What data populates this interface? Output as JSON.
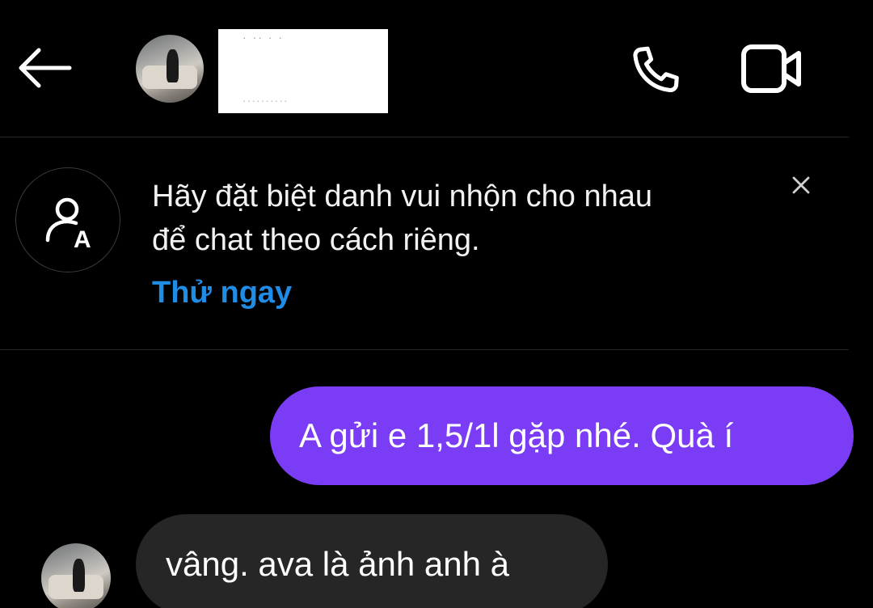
{
  "header": {
    "contact_name_fragment": "· ·· ·  ·",
    "contact_username_fragment": "··········"
  },
  "banner": {
    "line1": "Hãy đặt biệt danh vui nhộn cho nhau",
    "line2": "để chat theo cách riêng.",
    "action_label": "Thử ngay",
    "close_glyph": "×"
  },
  "messages": [
    {
      "direction": "outgoing",
      "text": "A gửi e 1,5/1l gặp nhé. Quà í"
    },
    {
      "direction": "incoming",
      "text": "vâng. ava là ảnh anh à"
    }
  ],
  "colors": {
    "background": "#000000",
    "outgoing_bubble": "#7a3cf4",
    "incoming_bubble": "#262626",
    "link": "#1f8ce6"
  },
  "icons": [
    "back-arrow-icon",
    "phone-icon",
    "video-camera-icon",
    "nickname-icon",
    "close-icon"
  ]
}
